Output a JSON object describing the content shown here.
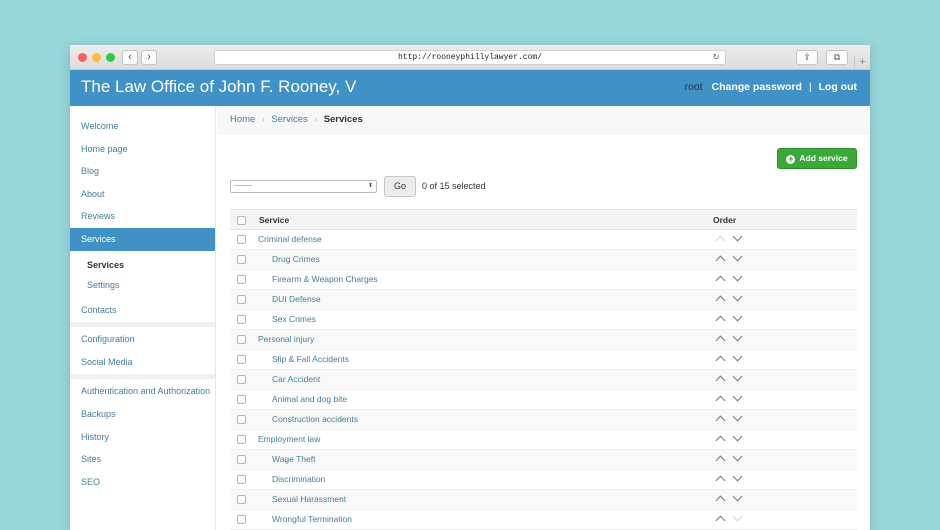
{
  "browser": {
    "url": "http://rooneyphillylawyer.com/",
    "back_glyph": "‹",
    "forward_glyph": "›",
    "reload_glyph": "↻",
    "share_glyph": "⇪",
    "tabs_glyph": "⧉",
    "newtab_glyph": "+"
  },
  "header": {
    "site_title": "The Law Office of John F. Rooney, V",
    "username": "root",
    "change_password": "Change password",
    "separator": "|",
    "logout": "Log out"
  },
  "sidebar": {
    "items": [
      {
        "label": "Welcome"
      },
      {
        "label": "Home page"
      },
      {
        "label": "Blog"
      },
      {
        "label": "About"
      },
      {
        "label": "Reviews"
      },
      {
        "label": "Services"
      },
      {
        "label": "Services"
      },
      {
        "label": "Settings"
      },
      {
        "label": "Contacts"
      },
      {
        "label": "Configuration"
      },
      {
        "label": "Social Media"
      },
      {
        "label": "Authentication and Authorization"
      },
      {
        "label": "Backups"
      },
      {
        "label": "History"
      },
      {
        "label": "Sites"
      },
      {
        "label": "SEO"
      }
    ]
  },
  "breadcrumbs": {
    "home": "Home",
    "services": "Services",
    "current": "Services",
    "separator": "›"
  },
  "toolbar": {
    "add_label": "Add service",
    "add_icon": "+",
    "action_placeholder": "---------",
    "select_arrows": "⬍",
    "go_label": "Go",
    "selection_count": "0 of 15 selected"
  },
  "table": {
    "col_service": "Service",
    "col_order": "Order",
    "rows": [
      {
        "name": "Criminal defense"
      },
      {
        "name": "Drug Crimes"
      },
      {
        "name": "Firearm & Weapon Charges"
      },
      {
        "name": "DUI Defense"
      },
      {
        "name": "Sex Crimes"
      },
      {
        "name": "Personal injury"
      },
      {
        "name": "Slip & Fall Accidents"
      },
      {
        "name": "Car Accident"
      },
      {
        "name": "Animal and dog bite"
      },
      {
        "name": "Construction accidents"
      },
      {
        "name": "Employment law"
      },
      {
        "name": "Wage Theft"
      },
      {
        "name": "Discrimination"
      },
      {
        "name": "Sexual Harassment"
      },
      {
        "name": "Wrongful Termination"
      }
    ]
  },
  "colors": {
    "header_bg": "#3f91c6",
    "link": "#447e9b",
    "add_button": "#3aa93a",
    "page_bg": "#97d6d9"
  }
}
